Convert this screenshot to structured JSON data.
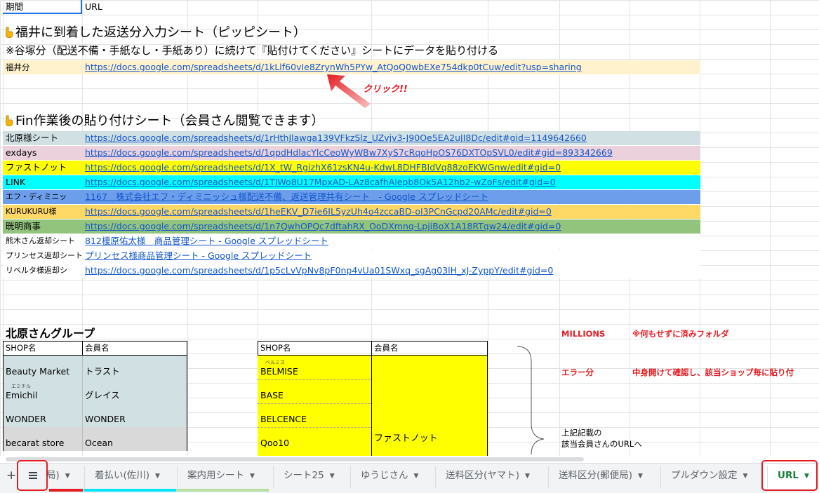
{
  "header_row": {
    "col_a": "期間",
    "col_b": "URL"
  },
  "section1": {
    "title": "福井に到着した返送分入力シート（ピッピシート）",
    "note": "※谷塚分（配送不備・手紙なし・手紙あり）に続けて『貼付けてください』シートにデータを貼り付ける",
    "row_label": "福井分",
    "row_url": "https://docs.google.com/spreadsheets/d/1kLlf60vIe8ZrynWh5PYw_AtQoQ0wbEXe754dkp0tCuw/edit?usp=sharing",
    "callout": "クリック!!"
  },
  "section2": {
    "title": "Fin作業後の貼り付けシート（会員さん閲覧できます）",
    "rows": [
      {
        "label": "北原様シート",
        "url": "https://docs.google.com/spreadsheets/d/1rHthJlawga139VFkzSlz_UZvjv3-J90Oe5EA2uJI8Dc/edit#gid=1149642660",
        "bg": "#d0e0e3"
      },
      {
        "label": "exdays",
        "url": "https://docs.google.com/spreadsheets/d/1qpdHdlacYlcCeoWyWBw7XyS7cRqoHpOS76DXTOpSVL0/edit#gid=893342669",
        "bg": "#ead1dc"
      },
      {
        "label": "ファストノット",
        "url": "https://docs.google.com/spreadsheets/d/1X_tW_RgizhX61zsKN4u-KdwL8DHFBIdVq88zoEKWGnw/edit#gid=0",
        "bg": "#ffff00"
      },
      {
        "label": "LINK",
        "url": "https://docs.google.com/spreadsheets/d/1TJWo8U17MpxAD-LAz8cafhAlepb8Ok5A12hb2-wZoFs/edit#gid=0",
        "bg": "#00ffff"
      },
      {
        "label": "エフ・ディミニッ",
        "url": "1167　株式会社エフ・ディミニッシュ様配送不備、返送管理共有シート　- Google スプレッドシート",
        "bg": "#6d9eeb"
      },
      {
        "label": "KURUKURU様",
        "url": "https://docs.google.com/spreadsheets/d/1heEKV_D7ie6IL5yzUh4o4zccaBD-oI3PCnGcpd20AMc/edit#gid=0",
        "bg": "#ffd966"
      },
      {
        "label": "晄明商事",
        "url": "https://docs.google.com/spreadsheets/d/1n7QwhOPQc7dftahRX_OoDXmnq-LpjiBoX1A18RTqw24/edit#gid=0",
        "bg": "#93c47d"
      },
      {
        "label": "熊木さん返却シート",
        "url": "812榎原佑太様　商品管理シート - Google スプレッドシート",
        "bg": "#ffffff"
      },
      {
        "label": "プリンセス返却シート",
        "url": "プリンセス様商品管理シート - Google スプレッドシート",
        "bg": "#ffffff"
      },
      {
        "label": "リベルタ様返却シ",
        "url": "https://docs.google.com/spreadsheets/d/1p5cLvVpNv8pF0np4vUa01SWxq_sgAg03lH_xJ-ZyppY/edit#gid=0",
        "bg": "#ffffff"
      }
    ]
  },
  "section3": {
    "title": "北原さんグループ",
    "left_table": {
      "headers": [
        "SHOP名",
        "会員名"
      ],
      "rows": [
        {
          "shop": "Beauty Market",
          "member": "トラスト",
          "ruby": ""
        },
        {
          "shop": "Emichil",
          "member": "グレイス",
          "ruby": "エミチル"
        },
        {
          "shop": "WONDER",
          "member": "WONDER",
          "ruby": ""
        },
        {
          "shop": "becarat store",
          "member": "Ocean",
          "ruby": ""
        }
      ]
    },
    "right_table": {
      "headers": [
        "SHOP名",
        "会員名"
      ],
      "shops": [
        {
          "shop": "BELMISE",
          "ruby": "ベルミス"
        },
        {
          "shop": "BASE",
          "ruby": ""
        },
        {
          "shop": "BELCENCE",
          "ruby": ""
        },
        {
          "shop": "Qoo10",
          "ruby": ""
        }
      ],
      "member": "ファストノット"
    },
    "brace_note_line1": "上記記載の",
    "brace_note_line2": "該当会員さんのURLへ",
    "millions": "MILLIONS",
    "millions_note": "※何もせずに済みフォルダ",
    "error": "エラー分",
    "error_note": "中身開けて確認し、該当ショップ毎に貼り付"
  },
  "tabs": {
    "add": "+",
    "first_partial": "局)",
    "items": [
      "着払い(佐川)",
      "案内用シート",
      "シート25",
      "ゆうじさん",
      "送料区分(ヤマト)",
      "送料区分(郵便局)",
      "プルダウン設定",
      "URL"
    ]
  },
  "colors": {
    "accent": "#188038",
    "callout": "#e51c23",
    "link": "#1155cc"
  }
}
